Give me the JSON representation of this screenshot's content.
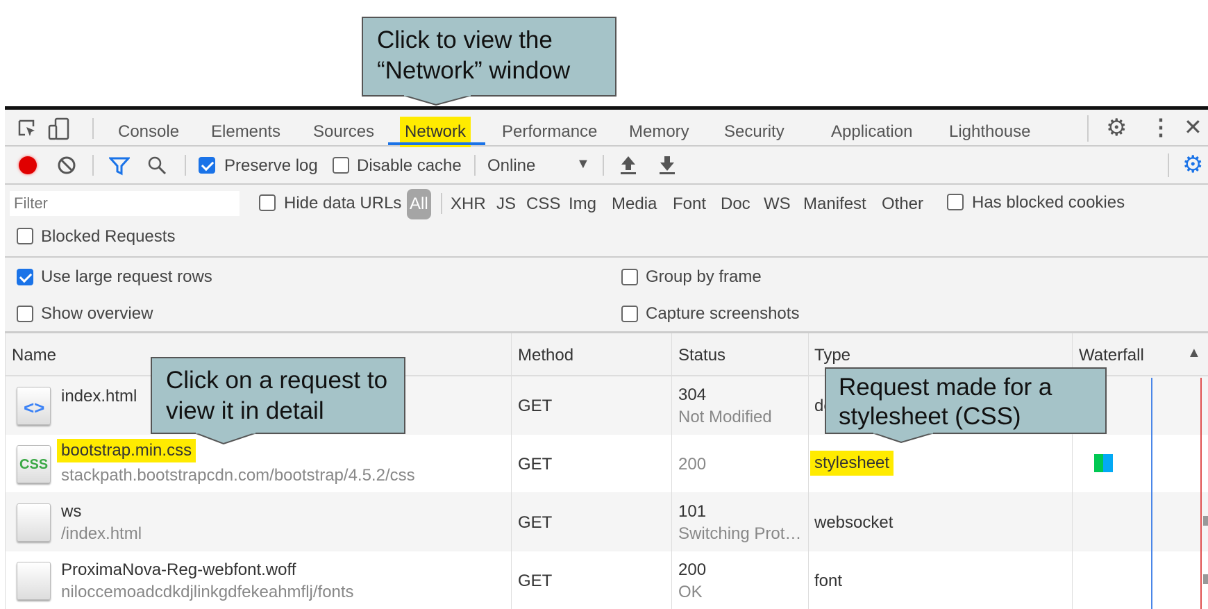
{
  "callouts": {
    "network": "Click to view the “Network” window",
    "request": "Click on a request to view it in detail",
    "stylesheet": "Request made for a stylesheet (CSS)"
  },
  "tabs": [
    "Console",
    "Elements",
    "Sources",
    "Network",
    "Performance",
    "Memory",
    "Security",
    "Application",
    "Lighthouse"
  ],
  "active_tab": "Network",
  "toolbar": {
    "preserve_log": "Preserve log",
    "preserve_log_checked": true,
    "disable_cache": "Disable cache",
    "disable_cache_checked": false,
    "throttle": "Online"
  },
  "filter": {
    "placeholder": "Filter",
    "hide_data_urls": "Hide data URLs",
    "types": [
      "All",
      "XHR",
      "JS",
      "CSS",
      "Img",
      "Media",
      "Font",
      "Doc",
      "WS",
      "Manifest",
      "Other"
    ],
    "active_type": "All",
    "has_blocked_cookies": "Has blocked cookies",
    "blocked_requests": "Blocked Requests"
  },
  "settings": {
    "large_rows": "Use large request rows",
    "large_rows_checked": true,
    "group_by_frame": "Group by frame",
    "show_overview": "Show overview",
    "capture_screenshots": "Capture screenshots"
  },
  "columns": [
    "Name",
    "Method",
    "Status",
    "Type",
    "Waterfall"
  ],
  "rows": [
    {
      "name": "index.html",
      "path": "",
      "method": "GET",
      "status": "304",
      "status_text": "Not Modified",
      "type": "document",
      "icon": "html-file-icon"
    },
    {
      "name": "bootstrap.min.css",
      "path": "stackpath.bootstrapcdn.com/bootstrap/4.5.2/css",
      "method": "GET",
      "status": "200",
      "status_text": "",
      "type": "stylesheet",
      "icon": "css-file-icon"
    },
    {
      "name": "ws",
      "path": "/index.html",
      "method": "GET",
      "status": "101",
      "status_text": "Switching Prot…",
      "type": "websocket",
      "icon": "blank-file-icon"
    },
    {
      "name": "ProximaNova-Reg-webfont.woff",
      "path": "niloccemoadcdkdjlinkgdfekeahmflj/fonts",
      "method": "GET",
      "status": "200",
      "status_text": "OK",
      "type": "font",
      "icon": "blank-file-icon"
    }
  ],
  "colors": {
    "highlight": "#ffeb00",
    "callout": "#a5c3c8",
    "accent": "#1a73e8",
    "record": "#e00000"
  }
}
